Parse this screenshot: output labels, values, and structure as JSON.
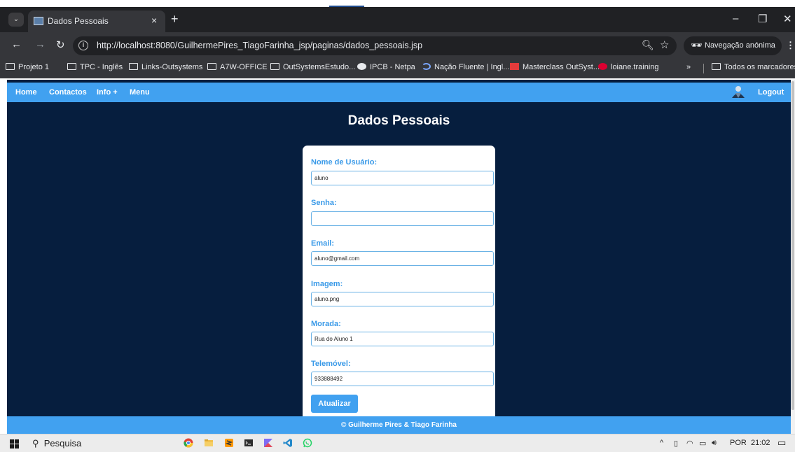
{
  "browser": {
    "tab_title": "Dados Pessoais",
    "url": "http://localhost:8080/GuilhermePires_TiagoFarinha_jsp/paginas/dados_pessoais.jsp",
    "incognito_label": "Navegação anónima",
    "bookmarks": [
      {
        "label": "Projeto 1",
        "icon": "folder-icon"
      },
      {
        "label": "TPC - Inglês",
        "icon": "folder-icon"
      },
      {
        "label": "Links-Outsystems",
        "icon": "folder-icon"
      },
      {
        "label": "A7W-OFFICE",
        "icon": "folder-icon"
      },
      {
        "label": "OutSystemsEstudo...",
        "icon": "folder-icon"
      },
      {
        "label": "IPCB - Netpa",
        "icon": "globe-icon"
      },
      {
        "label": "Nação Fluente | Ingl...",
        "icon": "moon-icon"
      },
      {
        "label": "Masterclass OutSyst...",
        "icon": "outsystems-icon"
      },
      {
        "label": "loiane.training",
        "icon": "angular-icon"
      }
    ],
    "bookmarks_overflow": "»",
    "all_bookmarks": "Todos os marcadores"
  },
  "navbar": {
    "links": [
      "Home",
      "Contactos",
      "Info +",
      "Menu"
    ],
    "logout": "Logout"
  },
  "page": {
    "title": "Dados Pessoais",
    "form": {
      "username_label": "Nome de Usuário:",
      "username_value": "aluno",
      "password_label": "Senha:",
      "password_value": "",
      "email_label": "Email:",
      "email_value": "aluno@gmail.com",
      "image_label": "Imagem:",
      "image_value": "aluno.png",
      "address_label": "Morada:",
      "address_value": "Rua do Aluno 1",
      "phone_label": "Telemóvel:",
      "phone_value": "933888492",
      "submit_label": "Atualizar"
    },
    "footer": "© Guilherme Pires & Tiago Farinha"
  },
  "taskbar": {
    "search_label": "Pesquisa",
    "language": "POR",
    "time": "21:02"
  },
  "colors": {
    "page_bg": "#061e3e",
    "accent": "#41a1f0",
    "label": "#3a9ae8"
  }
}
